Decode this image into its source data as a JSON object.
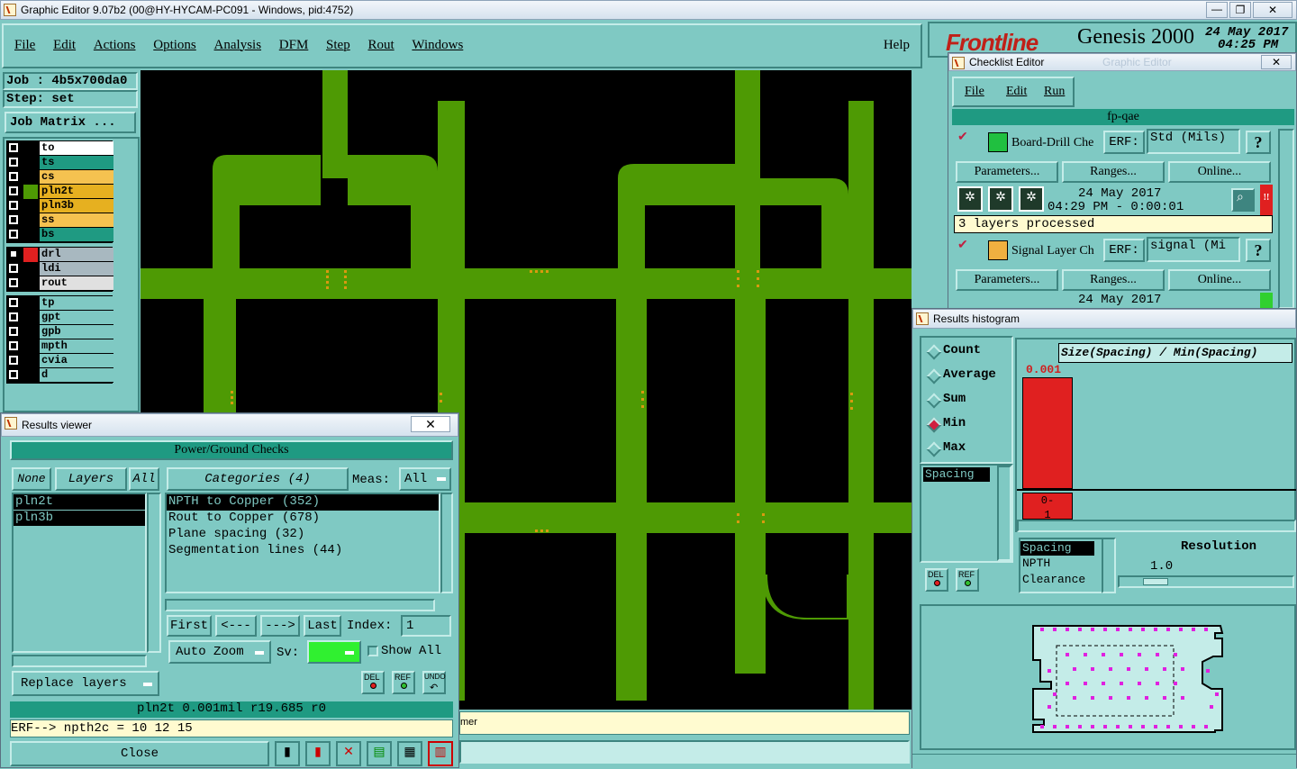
{
  "window": {
    "title": "Graphic Editor 9.07b2 (00@HY-HYCAM-PC091 - Windows, pid:4752)"
  },
  "menubar": {
    "items": [
      "File",
      "Edit",
      "Actions",
      "Options",
      "Analysis",
      "DFM",
      "Step",
      "Rout",
      "Windows"
    ],
    "help": "Help"
  },
  "brand": {
    "logo": "Frontline",
    "product": "Genesis 2000",
    "date": "24 May 2017",
    "time": "04:25 PM"
  },
  "job": {
    "job_label": "Job : 4b5x700da0",
    "step_label": "Step: set",
    "matrix_button": "Job Matrix ..."
  },
  "layers": {
    "group1": [
      {
        "name": "to",
        "color": "#ffffff"
      },
      {
        "name": "ts",
        "color": "#1f9a82"
      },
      {
        "name": "cs",
        "color": "#f5c250"
      },
      {
        "name": "pln2t",
        "color": "#e6b020"
      },
      {
        "name": "pln3b",
        "color": "#e6b020"
      },
      {
        "name": "ss",
        "color": "#f5c250"
      },
      {
        "name": "bs",
        "color": "#1f9a82"
      }
    ],
    "group2": [
      {
        "name": "drl",
        "color": "#a8b8c0"
      },
      {
        "name": "ldi",
        "color": "#a8b8c0"
      },
      {
        "name": "rout",
        "color": "#e0e0e0"
      }
    ],
    "group3": [
      {
        "name": "tp",
        "color": "#7fc9c3"
      },
      {
        "name": "gpt",
        "color": "#7fc9c3"
      },
      {
        "name": "gpb",
        "color": "#7fc9c3"
      },
      {
        "name": "mpth",
        "color": "#7fc9c3"
      },
      {
        "name": "cvia",
        "color": "#7fc9c3"
      },
      {
        "name": "d",
        "color": "#7fc9c3"
      }
    ]
  },
  "results_viewer": {
    "title": "Results viewer",
    "header": "Power/Ground Checks",
    "none": "None",
    "layers": "Layers",
    "all": "All",
    "categories": "Categories (4)",
    "meas_label": "Meas:",
    "meas_value": "All",
    "layer_list": [
      "pln2t",
      "pln3b"
    ],
    "category_list": [
      "NPTH to Copper (352)",
      "Rout to Copper (678)",
      "Plane spacing (32)",
      "Segmentation lines (44)"
    ],
    "first": "First",
    "prev": "<---",
    "next": "--->",
    "last": "Last",
    "index_label": "Index:",
    "index_value": "1",
    "auto_zoom": "Auto Zoom",
    "sv_label": "Sv:",
    "show_all": "Show All",
    "del": "DEL",
    "ref": "REF",
    "undo": "UNDO",
    "replace_layers": "Replace layers",
    "status": "pln2t 0.001mil r19.685 r0",
    "erf": "ERF--> npth2c = 10 12 15",
    "close": "Close"
  },
  "bottom_status": {
    "tail": "mer"
  },
  "checklist": {
    "title": "Checklist Editor",
    "ghost": "Graphic Editor",
    "menu": [
      "File",
      "Edit",
      "Run"
    ],
    "name": "fp-qae",
    "checks": [
      {
        "name": "Board-Drill Che",
        "erf_label": "ERF:",
        "erf_value": "Std (Mils)",
        "params": "Parameters...",
        "ranges": "Ranges...",
        "online": "Online...",
        "date": "24 May 2017",
        "time": "04:29 PM - 0:00:01",
        "status": "3 layers processed",
        "flag": "!!"
      },
      {
        "name": "Signal Layer Ch",
        "erf_label": "ERF:",
        "erf_value": "signal (Mi",
        "params": "Parameters...",
        "ranges": "Ranges...",
        "online": "Online...",
        "date": "24 May 2017"
      }
    ],
    "help": "?"
  },
  "histogram": {
    "title": "Results histogram",
    "options": [
      "Count",
      "Average",
      "Sum",
      "Min",
      "Max"
    ],
    "selected": "Min",
    "header": "Size(Spacing) / Min(Spacing)",
    "bar_value": "0.001",
    "bar_range": "0-\n1",
    "list": [
      "Spacing"
    ],
    "types": [
      "Spacing",
      "NPTH",
      "Clearance"
    ],
    "resolution_label": "Resolution",
    "resolution_value": "1.0",
    "del": "DEL",
    "ref": "REF"
  },
  "colors": {
    "copper": "#4e9a04",
    "bg": "#7fc9c3",
    "accent": "#e02020",
    "dots": "#e020e0"
  }
}
